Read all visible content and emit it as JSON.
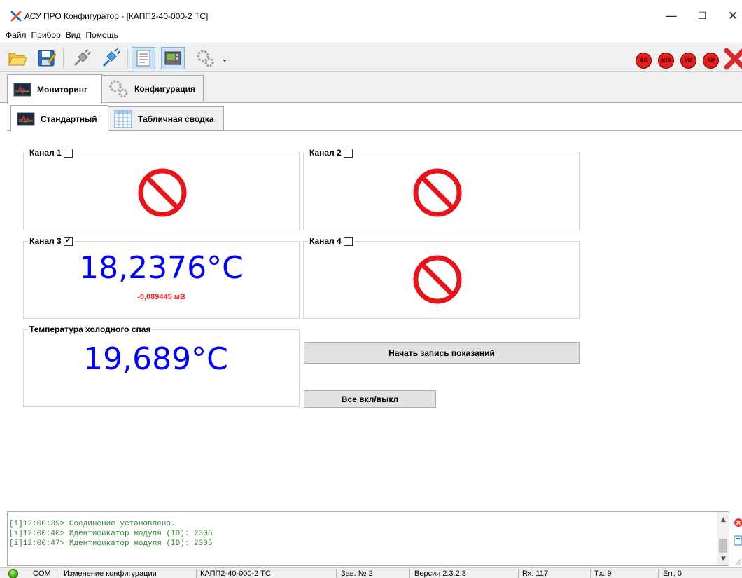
{
  "window": {
    "title": "АСУ ПРО Конфигуратор - [КАПП2-40-000-2 ТС]",
    "minimize": "—",
    "maximize": "☐",
    "close": "✕"
  },
  "menu": [
    "Файл",
    "Прибор",
    "Вид",
    "Помощь"
  ],
  "toolbar": {
    "icons": [
      "open-folder-icon",
      "save-icon",
      "disconnect-plug-icon",
      "connect-plug-icon",
      "monitor-list-icon",
      "device-panel-icon",
      "gears-dropdown-icon"
    ],
    "indicators": [
      "AG",
      "KM",
      "ME",
      "SP"
    ],
    "indicator_color": "#e21d1d"
  },
  "tabs": {
    "main": [
      {
        "label": "Мониторинг",
        "active": true
      },
      {
        "label": "Конфигурация",
        "active": false
      }
    ],
    "sub": [
      {
        "label": "Стандартный",
        "active": true
      },
      {
        "label": "Табличная сводка",
        "active": false
      }
    ]
  },
  "channels": [
    {
      "label": "Канал 1",
      "checked": false,
      "check_glyph": "",
      "value": "",
      "sub_value": "",
      "status": "disabled"
    },
    {
      "label": "Канал 2",
      "checked": false,
      "check_glyph": "",
      "value": "",
      "sub_value": "",
      "status": "disabled"
    },
    {
      "label": "Канал 3",
      "checked": true,
      "check_glyph": "✓",
      "value": "18,2376°C",
      "sub_value": "-0,089445 мВ",
      "status": "active"
    },
    {
      "label": "Канал 4",
      "checked": false,
      "check_glyph": "",
      "value": "",
      "sub_value": "",
      "status": "disabled"
    }
  ],
  "cold_junction": {
    "label": "Температура холодного спая",
    "value": "19,689°C"
  },
  "buttons": {
    "start_recording": "Начать запись показаний",
    "toggle_all": "Все вкл/выкл"
  },
  "log": [
    "[i]12:00:39> Соединение установлено.",
    "[i]12:00:40> Идентификатор модуля (ID): 2305",
    "[i]12:00:47> Идентификатор модуля (ID): 2305"
  ],
  "status_bar": {
    "port": "COM",
    "state": "Изменение конфигурации",
    "device": "КАПП2-40-000-2 ТС",
    "serial": "Зав. № 2",
    "version": "Версия 2.3.2.3",
    "rx": "Rx: 117",
    "tx": "Tx: 9",
    "err": "Err: 0"
  },
  "colors": {
    "value_blue": "#0000ff",
    "millivolt_red": "#ff2222",
    "log_green": "#3a8a3a",
    "no_signal_red": "#e8131b"
  }
}
